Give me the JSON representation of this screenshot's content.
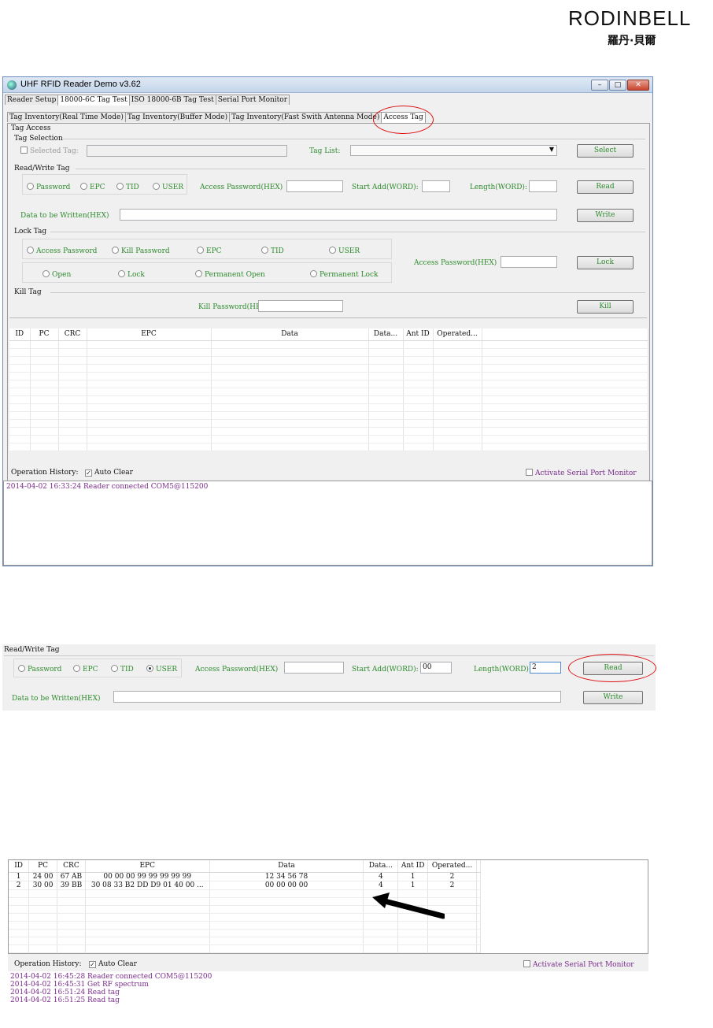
{
  "logo": {
    "text": "RODINBELL",
    "chinese": "羅丹·貝爾"
  },
  "window": {
    "title": "UHF RFID Reader Demo v3.62",
    "controls": {
      "minimize": "–",
      "maximize": "□",
      "close": "✕"
    }
  },
  "main_tabs": [
    "Reader Setup",
    "18000-6C Tag Test",
    "ISO 18000-6B Tag Test",
    "Serial Port Monitor"
  ],
  "sub_tabs": [
    "Tag Inventory(Real Time Mode)",
    "Tag Inventory(Buffer Mode)",
    "Tag Inventory(Fast Swith Antenna Mode)",
    "Access Tag"
  ],
  "access": {
    "group_title": "Tag Access",
    "selection": {
      "title": "Tag Selection",
      "selected_tag_label": "Selected Tag:",
      "tag_list_label": "Tag List:",
      "select_button": "Select"
    },
    "readwrite": {
      "title": "Read/Write Tag",
      "banks": [
        "Password",
        "EPC",
        "TID",
        "USER"
      ],
      "access_password_label": "Access Password(HEX)",
      "start_add_label": "Start Add(WORD):",
      "length_label": "Length(WORD):",
      "read_button": "Read",
      "data_written_label": "Data to be Written(HEX)",
      "write_button": "Write"
    },
    "lock": {
      "title": "Lock Tag",
      "targets": [
        "Access Password",
        "Kill Password",
        "EPC",
        "TID",
        "USER"
      ],
      "types": [
        "Open",
        "Lock",
        "Permanent Open",
        "Permanent Lock"
      ],
      "access_password_label": "Access Password(HEX)",
      "lock_button": "Lock"
    },
    "kill": {
      "title": "Kill Tag",
      "kill_password_label": "Kill Password(HEX)",
      "kill_button": "Kill"
    }
  },
  "table": {
    "headers": [
      "ID",
      "PC",
      "CRC",
      "EPC",
      "Data",
      "Data...",
      "Ant ID",
      "Operated..."
    ]
  },
  "history": {
    "label": "Operation History:",
    "auto_clear": "Auto Clear",
    "activate_monitor": "Activate Serial Port Monitor",
    "log1": [
      "2014-04-02 16:33:24 Reader connected COM5@115200"
    ]
  },
  "snippet2": {
    "title": "Read/Write Tag",
    "banks": [
      "Password",
      "EPC",
      "TID",
      "USER"
    ],
    "selected_bank": "USER",
    "access_password_label": "Access Password(HEX)",
    "start_add_label": "Start Add(WORD):",
    "start_add_value": "00",
    "length_label": "Length(WORD):",
    "length_value": "2",
    "read_button": "Read",
    "data_written_label": "Data to be Written(HEX)",
    "write_button": "Write"
  },
  "snippet3": {
    "headers": [
      "ID",
      "PC",
      "CRC",
      "EPC",
      "Data",
      "Data...",
      "Ant ID",
      "Operated..."
    ],
    "rows": [
      [
        "1",
        "24 00",
        "67 AB",
        "00 00 00 99 99 99 99 99",
        "12 34 56 78",
        "4",
        "1",
        "2"
      ],
      [
        "2",
        "30 00",
        "39 BB",
        "30 08 33 B2 DD D9 01 40 00 ...",
        "00 00 00 00",
        "4",
        "1",
        "2"
      ]
    ],
    "history_label": "Operation History:",
    "auto_clear": "Auto Clear",
    "activate_monitor": "Activate Serial Port Monitor",
    "log": [
      "2014-04-02 16:45:28 Reader connected COM5@115200",
      "2014-04-02 16:45:31 Get RF spectrum",
      "2014-04-02 16:51:24 Read tag",
      "2014-04-02 16:51:25 Read tag"
    ]
  },
  "colors": {
    "annotation": "#d11111",
    "label_green": "#2e8b2e",
    "log_purple": "#7a2b8b"
  }
}
